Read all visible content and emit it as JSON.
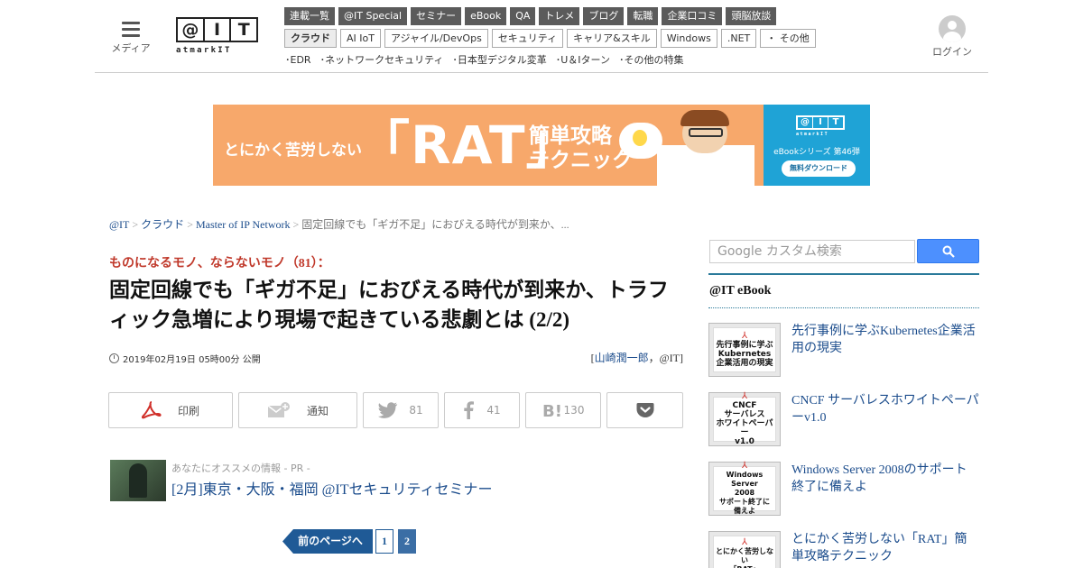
{
  "header": {
    "menu_label": "メディア",
    "logo_text": [
      "@",
      "I",
      "T"
    ],
    "logo_sub": "atmarkIT",
    "login_label": "ログイン",
    "nav_row1": [
      "連載一覧",
      "@IT Special",
      "セミナー",
      "eBook",
      "QA",
      "トレメ",
      "ブログ",
      "転職",
      "企業口コミ",
      "頭脳放談"
    ],
    "nav_row2": [
      "クラウド",
      "AI IoT",
      "アジャイル/DevOps",
      "セキュリティ",
      "キャリア&スキル",
      "Windows",
      ".NET",
      "・ その他"
    ],
    "nav_row2_active": "クラウド",
    "special_row": [
      "･EDR",
      "･ネットワークセキュリティ",
      "･日本型デジタル変革",
      "･U＆Iターン",
      "･その他の特集"
    ]
  },
  "banner": {
    "text1": "とにかく苦労しない",
    "rat": "「RAT」",
    "text2_line1": "簡単攻略",
    "text2_line2": "テクニック",
    "logo_text": [
      "@",
      "I",
      "T"
    ],
    "logo_sub": "atmarkIT",
    "series": "eBookシリーズ 第46弾",
    "download": "無料ダウンロード"
  },
  "breadcrumb": {
    "items": [
      "@IT",
      "クラウド",
      "Master of IP Network"
    ],
    "separator": ">",
    "current": "固定回線でも「ギガ不足」におびえる時代が到来か、..."
  },
  "article": {
    "series": "ものになるモノ、ならないモノ（81）：",
    "title": "固定回線でも「ギガ不足」におびえる時代が到来か、トラフィック急増により現場で起きている悲劇とは (2/2)",
    "date": "2019年02月19日 05時00分 公開",
    "author_open": "[",
    "author_name": "山崎潤一郎",
    "author_rest": "，@IT]"
  },
  "share": {
    "print_label": "印刷",
    "notify_label": "通知",
    "twitter_count": "81",
    "facebook_count": "41",
    "hatena_count": "130"
  },
  "pr": {
    "label": "あなたにオススメの情報 - PR -",
    "link": "[2月]東京・大阪・福岡 @ITセキュリティセミナー"
  },
  "pagination": {
    "prev": "前のページへ",
    "pages": [
      "1",
      "2"
    ],
    "current": "2"
  },
  "sidebar": {
    "search_placeholder": "Google カスタム検索",
    "section_title": "@IT eBook",
    "ebooks": [
      {
        "cover": "先行事例に学ぶ\nKubernetes\n企業活用の現実",
        "title": "先行事例に学ぶKubernetes企業活用の現実"
      },
      {
        "cover": "CNCF\nサーバレス\nホワイトペーパー\nv1.0",
        "title": "CNCF サーバレスホワイトペーパーv1.0"
      },
      {
        "cover": "Windows Server\n2008\nサポート終了に\n備えよ",
        "title": "Windows Server 2008のサポート終了に備えよ"
      },
      {
        "cover": "とにかく苦労しない\n「RAT」",
        "title": "とにかく苦労しない「RAT」簡単攻略テクニック"
      }
    ]
  },
  "colors": {
    "link": "#1b4c8c",
    "series_red": "#c0392b",
    "banner_orange": "#f7a86b",
    "banner_blue": "#1fa3d6",
    "pagination_blue": "#1f5a96",
    "google_blue": "#4d90fe"
  }
}
